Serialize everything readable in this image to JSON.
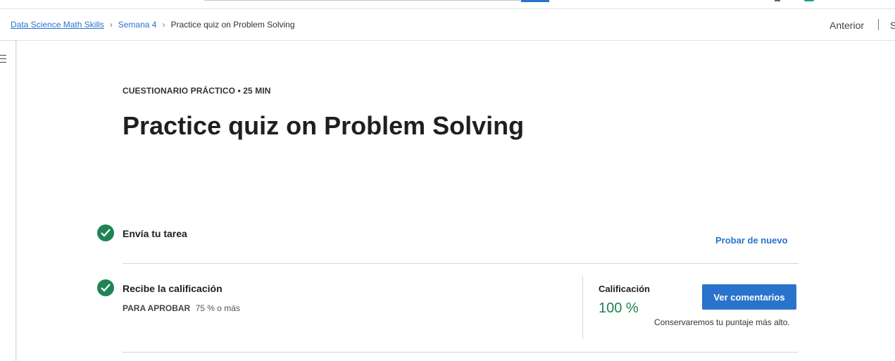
{
  "breadcrumb": {
    "items": [
      {
        "label": "Data Science Math Skills"
      },
      {
        "label": "Semana 4"
      }
    ],
    "current": "Practice quiz on Problem Solving"
  },
  "nav": {
    "previous": "Anterior",
    "next": "S"
  },
  "header": {
    "eyebrow": "CUESTIONARIO PRÁCTICO • 25 MIN",
    "title": "Practice quiz on Problem Solving"
  },
  "steps": [
    {
      "title": "Envía tu tarea",
      "status": "complete"
    },
    {
      "title": "Recibe la calificación",
      "status": "complete"
    }
  ],
  "submit": {
    "retry_label": "Probar de nuevo"
  },
  "grade": {
    "pass_key": "PARA APROBAR",
    "pass_value": "75 % o más",
    "label": "Calificación",
    "value": "100 %",
    "feedback_button": "Ver comentarios",
    "note": "Conservaremos tu puntaje más alto."
  },
  "colors": {
    "accent": "#2a73cc",
    "success": "#1f8354"
  },
  "icons": {
    "menu": "menu-icon",
    "check": "check-circle-icon",
    "chevron": "chevron-right-icon"
  }
}
